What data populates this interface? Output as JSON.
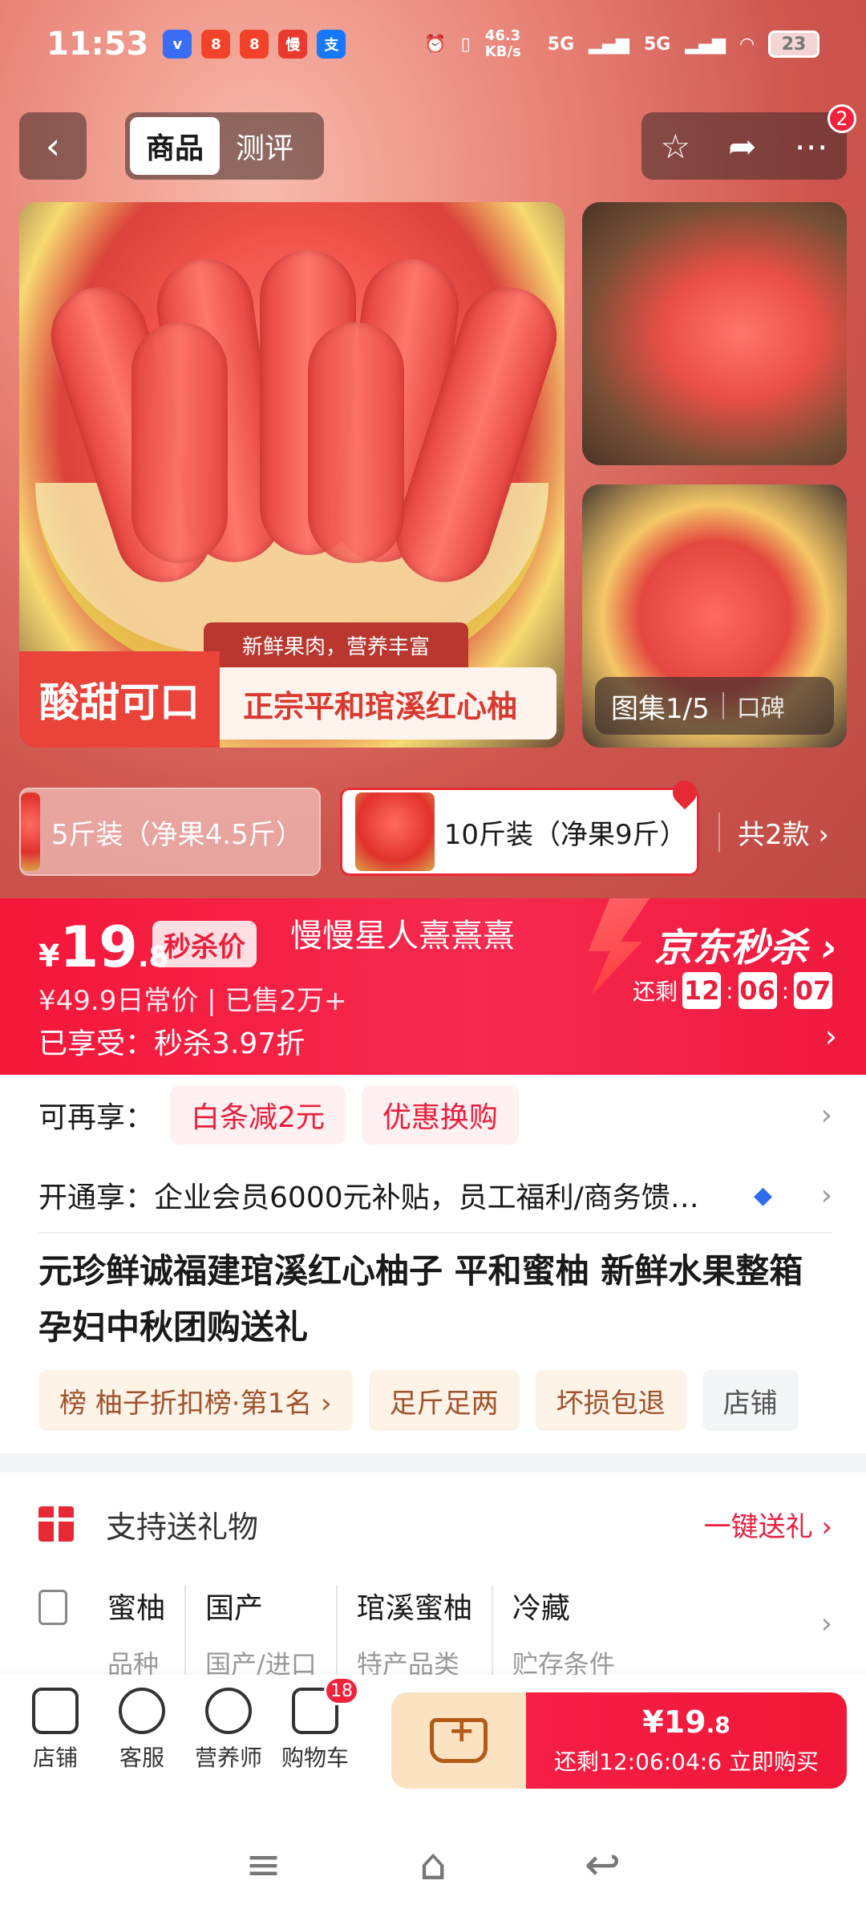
{
  "status_bar": {
    "time": "11:53",
    "net_speed": "46.3 KB/s",
    "network_1": "5G",
    "network_2": "5G",
    "battery": "23"
  },
  "top_nav": {
    "tab_goods": "商品",
    "tab_review": "测评",
    "more_badge": "2"
  },
  "hero": {
    "label_red": "酸甜可口",
    "label_white": "正宗平和琯溪红心柚",
    "label_tag": "新鲜果肉，营养丰富",
    "gallery": "图集1/5",
    "koubei": "口碑"
  },
  "variants": {
    "v1": "5斤装（净果4.5斤）",
    "v2": "10斤装（净果9斤）",
    "more": "共2款 ›"
  },
  "price_banner": {
    "yen": "¥",
    "price_int": "19",
    "price_dec": ".8",
    "seckill_tag": "秒杀价",
    "watermark": "慢慢星人熹熹熹",
    "orig_line": "¥49.9日常价 | 已售2万+",
    "enjoy_line": "已享受：秒杀3.97折",
    "jd_title": "京东秒杀 ›",
    "remain_label": "还剩",
    "cd_h": "12",
    "cd_m": "06",
    "cd_s": "07"
  },
  "promo": {
    "re_label": "可再享：",
    "pill1": "白条减2元",
    "pill2": "优惠换购",
    "open_label": "开通享：",
    "open_text": "企业会员6000元补贴，员工福利/商务馈…"
  },
  "product": {
    "title": "元珍鲜诚福建琯溪红心柚子 平和蜜柚 新鲜水果整箱 孕妇中秋团购送礼",
    "tags": [
      "榜 柚子折扣榜·第1名 ›",
      "足斤足两",
      "坏损包退",
      "店铺"
    ]
  },
  "gift": {
    "label": "支持送礼物",
    "link": "一键送礼 ›"
  },
  "specs": [
    {
      "value": "蜜柚",
      "key": "品种"
    },
    {
      "value": "国产",
      "key": "国产/进口"
    },
    {
      "value": "琯溪蜜柚",
      "key": "特产品类"
    },
    {
      "value": "冷藏",
      "key": "贮存条件"
    }
  ],
  "bottom_bar": {
    "shop": "店铺",
    "service": "客服",
    "nutritionist": "营养师",
    "cart": "购物车",
    "cart_badge": "18",
    "buy_price": "¥19",
    "buy_price_dec": ".8",
    "buy_line": "还剩12:06:04:6 立即购买"
  },
  "colors": {
    "accent_red": "#f5173a",
    "promo_pill_bg": "#fff0f1",
    "tag_bg": "#fdf3e7",
    "add_cart_bg": "#fbe2c3"
  }
}
